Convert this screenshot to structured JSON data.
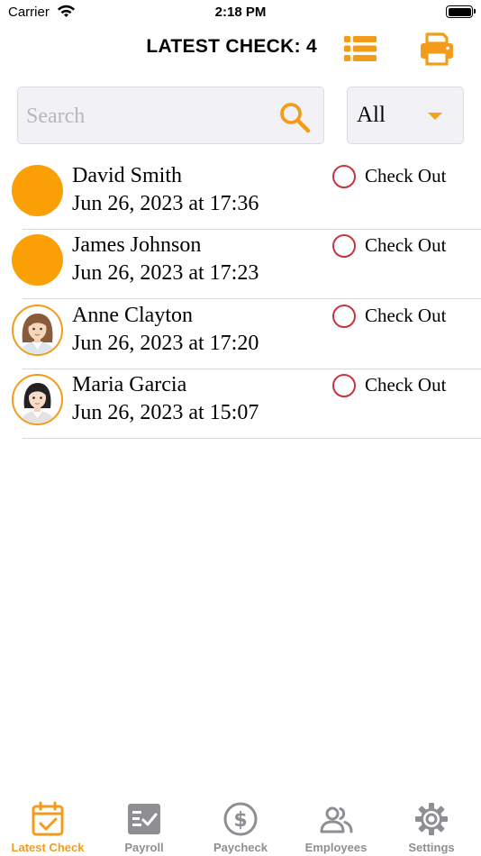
{
  "status_bar": {
    "carrier": "Carrier",
    "time": "2:18 PM"
  },
  "header": {
    "title": "LATEST CHECK: 4",
    "list_icon": "list-icon",
    "print_icon": "printer-icon"
  },
  "search": {
    "placeholder": "Search",
    "value": ""
  },
  "filter": {
    "selected": "All"
  },
  "entries": [
    {
      "name": "David Smith",
      "datetime": "Jun 26, 2023 at 17:36",
      "action": "Check Out",
      "avatar": "placeholder"
    },
    {
      "name": "James Johnson",
      "datetime": "Jun 26, 2023 at 17:23",
      "action": "Check Out",
      "avatar": "placeholder"
    },
    {
      "name": "Anne Clayton",
      "datetime": "Jun 26, 2023 at 17:20",
      "action": "Check Out",
      "avatar": "woman-brown-hair"
    },
    {
      "name": "Maria Garcia",
      "datetime": "Jun 26, 2023 at 15:07",
      "action": "Check Out",
      "avatar": "woman-black-hair"
    }
  ],
  "tabs": [
    {
      "label": "Latest Check",
      "icon": "calendar-check-icon",
      "active": true
    },
    {
      "label": "Payroll",
      "icon": "payroll-icon",
      "active": false
    },
    {
      "label": "Paycheck",
      "icon": "dollar-circle-icon",
      "active": false
    },
    {
      "label": "Employees",
      "icon": "people-icon",
      "active": false
    },
    {
      "label": "Settings",
      "icon": "gear-icon",
      "active": false
    }
  ],
  "colors": {
    "accent": "#f39c1c",
    "avatar_placeholder": "#fb9f06",
    "radio": "#c8343d",
    "inactive": "#8e8e93"
  }
}
